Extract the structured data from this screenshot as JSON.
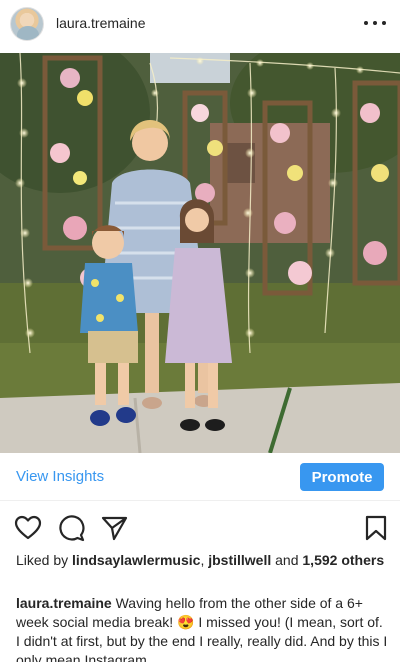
{
  "header": {
    "username": "laura.tremaine",
    "more_icon": "more-horizontal-icon"
  },
  "photo": {
    "subject": "post-photo"
  },
  "insights": {
    "view_label": "View Insights",
    "promote_label": "Promote"
  },
  "actions": {
    "like_icon": "heart-icon",
    "comment_icon": "comment-icon",
    "share_icon": "send-icon",
    "save_icon": "bookmark-icon"
  },
  "likes": {
    "prefix": "Liked by",
    "user1": "lindsaylawlermusic",
    "separator": ",",
    "user2": "jbstillwell",
    "conjunction": "and",
    "count": "1,592",
    "suffix": "others"
  },
  "caption": {
    "username": "laura.tremaine",
    "text_part1": "Waving hello from the other side of a 6+ week social media break!",
    "emoji": "😍",
    "text_part2": "I missed you! (I mean, sort of. I didn't at first, but by the end I really, really did. And by this I only mean Instagram."
  },
  "colors": {
    "accent": "#3897f0",
    "text": "#262626"
  }
}
